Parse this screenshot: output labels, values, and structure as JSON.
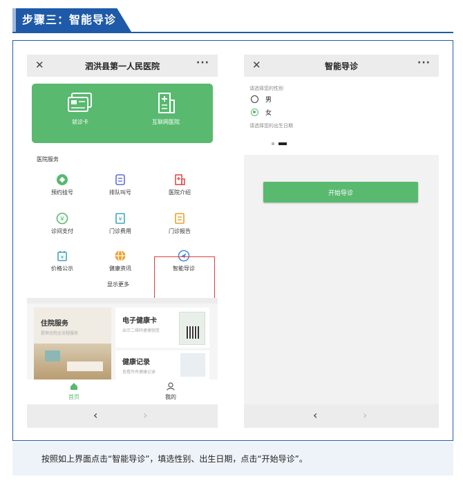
{
  "header": {
    "step_title": "步骤三：智能导诊"
  },
  "left_phone": {
    "title": "泗洪县第一人民医院",
    "close_glyph": "✕",
    "more_glyph": "···",
    "card_items": [
      {
        "label": "就诊卡",
        "icon": "card-icon"
      },
      {
        "label": "互联网医院",
        "icon": "hospital-icon"
      }
    ],
    "section_title": "医院服务",
    "services": [
      {
        "label": "预约挂号",
        "icon": "appointment-icon"
      },
      {
        "label": "排队叫号",
        "icon": "queue-icon"
      },
      {
        "label": "医院介绍",
        "icon": "hospital-info-icon"
      },
      {
        "label": "诊间支付",
        "icon": "payment-icon"
      },
      {
        "label": "门诊费用",
        "icon": "fee-icon"
      },
      {
        "label": "门诊报告",
        "icon": "report-icon"
      },
      {
        "label": "价格公示",
        "icon": "price-icon"
      },
      {
        "label": "健康资讯",
        "icon": "news-icon"
      },
      {
        "label": "智能导诊",
        "icon": "navigate-icon"
      }
    ],
    "show_more": "显示更多",
    "banners": {
      "inpatient": {
        "title": "住院服务",
        "subtitle": "提供住院全流程服务"
      },
      "health_card": {
        "title": "电子健康卡",
        "subtitle": "出示二维码便捷就医"
      },
      "health_record": {
        "title": "健康记录",
        "subtitle": "查看所有健康记录"
      }
    },
    "tabs": [
      {
        "label": "首页",
        "icon": "home-icon"
      },
      {
        "label": "我的",
        "icon": "user-icon"
      }
    ],
    "nav": {
      "back": "‹",
      "forward": "›"
    }
  },
  "right_phone": {
    "title": "智能导诊",
    "close_glyph": "✕",
    "more_glyph": "···",
    "gender_hint": "请选择您的性别",
    "gender_options": [
      {
        "label": "男",
        "checked": false
      },
      {
        "label": "女",
        "checked": true
      }
    ],
    "birth_hint": "请选择您的出生日期",
    "start_button": "开始导诊",
    "nav": {
      "back": "‹",
      "forward": "›"
    }
  },
  "caption": "按照如上界面点击“智能导诊”，填选性别、出生日期，点击“开始导诊”。",
  "colors": {
    "brand_blue": "#1e5aa8",
    "accent_green": "#58b96f",
    "highlight_red": "#e23b3b"
  }
}
